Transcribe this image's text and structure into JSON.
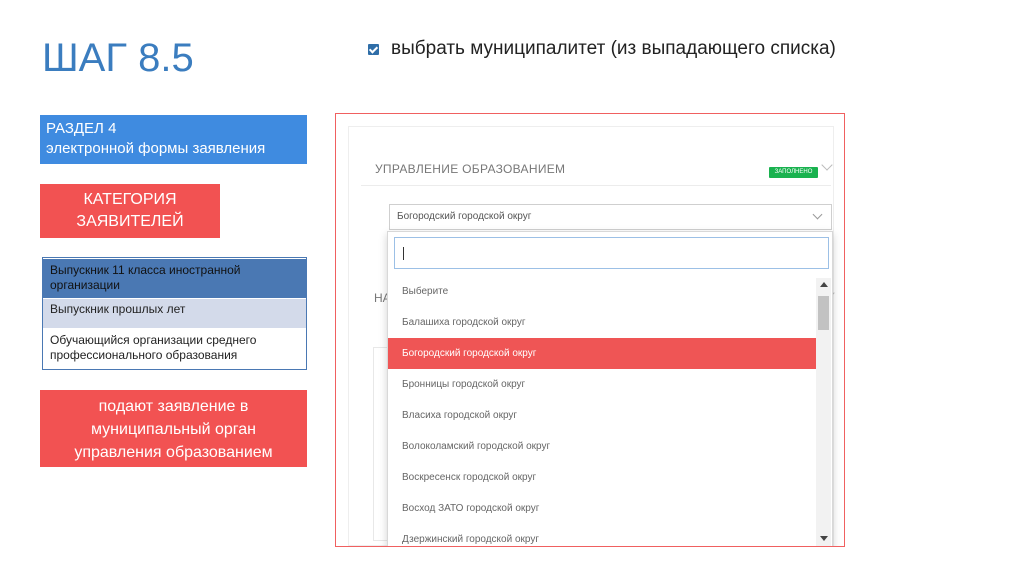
{
  "slide": {
    "title": "ШАГ 8.5",
    "instruction": "выбрать муниципалитет (из выпадающего списка)"
  },
  "sidebar": {
    "section_line1": "РАЗДЕЛ 4",
    "section_line2": "электронной формы заявления",
    "category_line1": "КАТЕГОРИЯ",
    "category_line2": "ЗАЯВИТЕЛЕЙ",
    "applicants": [
      "Выпускник 11 класса иностранной организации",
      "Выпускник прошлых лет",
      "Обучающийся организации среднего профессионального образования"
    ],
    "submit_line1": "подают заявление в",
    "submit_line2": "муниципальный орган",
    "submit_line3": "управления образованием"
  },
  "form": {
    "heading": "УПРАВЛЕНИЕ ОБРАЗОВАНИЕМ",
    "status": "ЗАПОЛНЕНО",
    "selected_value": "Богородский городской округ",
    "hidden_heading": "НА",
    "search_value": "",
    "options": [
      "Выберите",
      "Балашиха городской округ",
      "Богородский городской округ",
      "Бронницы городской округ",
      "Власиха городской округ",
      "Волоколамский городской округ",
      "Воскресенск городской округ",
      "Восход ЗАТО городской округ",
      "Дзержинский городской округ"
    ],
    "selected_index": 2
  },
  "colors": {
    "title": "#3b7dbf",
    "section_blue": "#3f8be0",
    "accent_red": "#f25252",
    "table_header": "#4a78b3",
    "table_row": "#d3daea",
    "status_green": "#19b24f",
    "selected_option": "#ef5555"
  },
  "icons": {
    "bullet": "checkbox-icon",
    "select": "chevron-down-icon",
    "scroll_up": "triangle-up-icon",
    "scroll_down": "triangle-down-icon"
  }
}
